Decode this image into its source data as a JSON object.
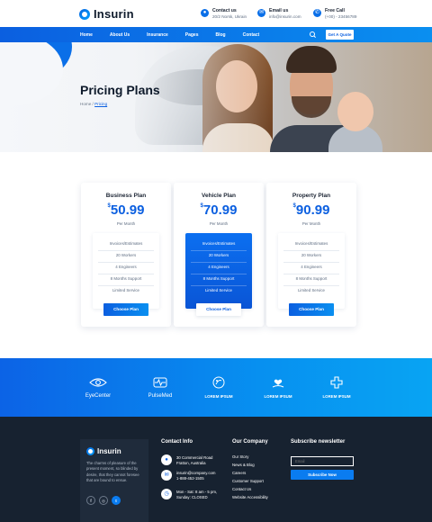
{
  "header": {
    "logo_text": "Insurin",
    "contacts": [
      {
        "title": "Contact us",
        "value": "20/2 Norsk, Ukrain",
        "icon": "location-icon"
      },
      {
        "title": "Email us",
        "value": "info@insurin.com",
        "icon": "mail-icon"
      },
      {
        "title": "Free Call",
        "value": "(+00) - 23456789",
        "icon": "phone-icon"
      }
    ]
  },
  "nav": {
    "items": [
      "Home",
      "About Us",
      "Insurance",
      "Pages",
      "Blog",
      "Contact"
    ],
    "quote_label": "Get A Quote"
  },
  "hero": {
    "title": "Pricing Plans",
    "breadcrumb_home": "Home",
    "breadcrumb_sep": "/",
    "breadcrumb_current": "Pricing"
  },
  "pricing": {
    "plans": [
      {
        "name": "Business Plan",
        "currency": "$",
        "price": "50.99",
        "period": "Per Month",
        "features": [
          "Invoices/Estimates",
          "20 Workers",
          "4 Engineers",
          "8 Months Support",
          "Limited Service"
        ],
        "button": "Choose Plan",
        "highlighted": false
      },
      {
        "name": "Vehicle Plan",
        "currency": "$",
        "price": "70.99",
        "period": "Per Month",
        "features": [
          "Invoices/Estimates",
          "20 Workers",
          "4 Engineers",
          "8 Months Support",
          "Limited Service"
        ],
        "button": "Choose Plan",
        "highlighted": true
      },
      {
        "name": "Property Plan",
        "currency": "$",
        "price": "90.99",
        "period": "Per Month",
        "features": [
          "Invoices/Estimates",
          "20 Workers",
          "4 Engineers",
          "8 Months Support",
          "Limited Service"
        ],
        "button": "Choose Plan",
        "highlighted": false
      }
    ]
  },
  "brands": [
    {
      "name": "EyeCenter",
      "sub": "",
      "icon": "eye-icon"
    },
    {
      "name": "PulseMed",
      "sub": "",
      "icon": "pulse-icon"
    },
    {
      "name": "LOREM IPSUM",
      "sub": "",
      "icon": "globe-icon"
    },
    {
      "name": "LOREM IPSUM",
      "sub": "",
      "icon": "heart-hand-icon"
    },
    {
      "name": "LOREM IPSUM",
      "sub": "",
      "icon": "cross-icon"
    }
  ],
  "footer": {
    "logo_text": "Insurin",
    "description": "The charms of pleasure of the present moment, so blinded by desire, that they cannot foresee that are bound to ensue.",
    "socials": [
      "f",
      "◎",
      "t"
    ],
    "contact_heading": "Contact Info",
    "contact_items": [
      {
        "icon": "location-icon",
        "lines": [
          "30 Commercial Road",
          "Fratton, Australia"
        ]
      },
      {
        "icon": "mail-icon",
        "lines": [
          "insurin@company.com",
          "1-888-452-1505"
        ]
      },
      {
        "icon": "clock-icon",
        "lines": [
          "Mon - Sat: 8 am - 5 pm,",
          "Sunday: CLOSED"
        ]
      }
    ],
    "company_heading": "Our Company",
    "company_links": [
      "Our Story",
      "News & Blog",
      "Careers",
      "Customer Support",
      "Contact Us",
      "Website Accessibility"
    ],
    "newsletter_heading": "Subscribe newsletter",
    "email_placeholder": "Email",
    "subscribe_label": "Subscribe Now"
  },
  "colors": {
    "primary": "#0b5fe0",
    "accent": "#0a8ff0",
    "footer_bg": "#172230"
  }
}
